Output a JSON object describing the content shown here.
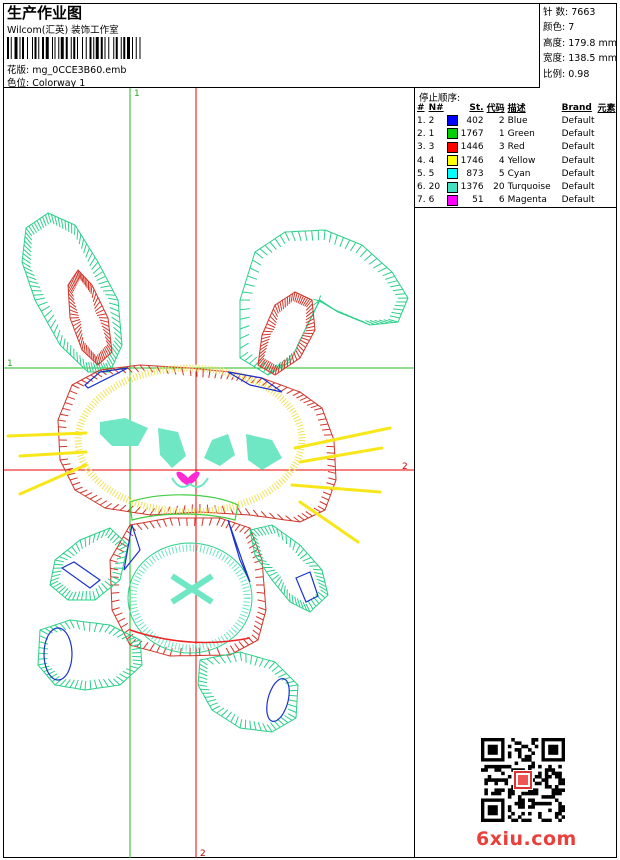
{
  "header": {
    "title": "生产作业图",
    "company": "Wilcom(汇英) 装饰工作室",
    "design_label": "花版:",
    "design_file": "mg_0CCE3B60.emb",
    "colorway_label": "色位:",
    "colorway": "Colorway 1"
  },
  "stats": [
    {
      "label": "针 数:",
      "value": "7663"
    },
    {
      "label": "颜色:",
      "value": "7"
    },
    {
      "label": "高度:",
      "value": "179.8 mm"
    },
    {
      "label": "宽度:",
      "value": "138.5 mm"
    },
    {
      "label": "比例:",
      "value": "0.98"
    }
  ],
  "sequence": {
    "title": "停止顺序:",
    "headers": [
      "#",
      "N#",
      "St.",
      "代码",
      "描述",
      "Brand",
      "元素"
    ],
    "rows": [
      {
        "idx": "1.",
        "n": "2",
        "st": "402",
        "code": "2",
        "desc": "Blue",
        "brand": "Default",
        "color": "#0000ff"
      },
      {
        "idx": "2.",
        "n": "1",
        "st": "1767",
        "code": "1",
        "desc": "Green",
        "brand": "Default",
        "color": "#00d000"
      },
      {
        "idx": "3.",
        "n": "3",
        "st": "1446",
        "code": "3",
        "desc": "Red",
        "brand": "Default",
        "color": "#ff0000"
      },
      {
        "idx": "4.",
        "n": "4",
        "st": "1746",
        "code": "4",
        "desc": "Yellow",
        "brand": "Default",
        "color": "#ffff00"
      },
      {
        "idx": "5.",
        "n": "5",
        "st": "873",
        "code": "5",
        "desc": "Cyan",
        "brand": "Default",
        "color": "#00ffff"
      },
      {
        "idx": "6.",
        "n": "20",
        "st": "1376",
        "code": "20",
        "desc": "Turquoise",
        "brand": "Default",
        "color": "#40e0c0"
      },
      {
        "idx": "7.",
        "n": "6",
        "st": "51",
        "code": "6",
        "desc": "Magenta",
        "brand": "Default",
        "color": "#ff00ff"
      }
    ]
  },
  "axes": {
    "v1": "1",
    "h1": "1",
    "h2": "2",
    "v2": "2"
  },
  "watermark": "6xiu.com"
}
